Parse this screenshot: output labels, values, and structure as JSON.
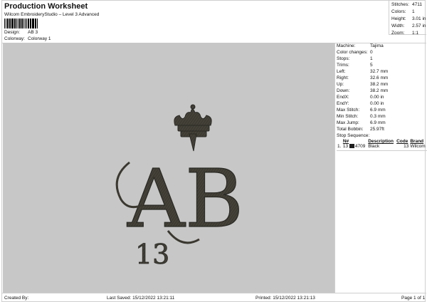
{
  "header": {
    "title": "Production Worksheet",
    "subtitle": "Wilcom EmbroideryStudio – Level 3 Advanced",
    "design_label": "Design:",
    "design_value": "AB 3",
    "colorway_label": "Colorway:",
    "colorway_value": "Colorway 1"
  },
  "stats": [
    {
      "label": "Stitches:",
      "value": "4711"
    },
    {
      "label": "Colors:",
      "value": "1"
    },
    {
      "label": "Height:",
      "value": "3.01 in"
    },
    {
      "label": "Width:",
      "value": "2.57 in"
    },
    {
      "label": "Zoom:",
      "value": "1:1"
    }
  ],
  "machine": [
    {
      "label": "Machine:",
      "value": "Tajima"
    },
    {
      "label": "Color changes:",
      "value": "0"
    },
    {
      "label": "Stops:",
      "value": "1"
    },
    {
      "label": "Trims:",
      "value": "5"
    },
    {
      "label": "Left:",
      "value": "32.7 mm"
    },
    {
      "label": "Right:",
      "value": "32.6 mm"
    },
    {
      "label": "Up:",
      "value": "38.2 mm"
    },
    {
      "label": "Down:",
      "value": "38.2 mm"
    },
    {
      "label": "EndX:",
      "value": "0.00 in"
    },
    {
      "label": "EndY:",
      "value": "0.00 in"
    },
    {
      "label": "Max Stitch:",
      "value": "6.9 mm"
    },
    {
      "label": "Min Stitch:",
      "value": "0.3 mm"
    },
    {
      "label": "Max Jump:",
      "value": "6.9 mm"
    },
    {
      "label": "Total Bobbin:",
      "value": "25.97ft"
    }
  ],
  "stop_sequence": {
    "title": "Stop Sequence:",
    "columns": [
      "N#",
      "Description",
      "Code",
      "Brand"
    ],
    "rows": [
      {
        "index": "1.",
        "n": "13",
        "stitches": "4709",
        "description": "Black",
        "code": "13",
        "brand": "Wilcom",
        "color": "#1f1f1f"
      }
    ]
  },
  "design_art": {
    "letters": "AB",
    "number": "13",
    "fill_color": "#3a382f",
    "background_color": "#c7c7c7"
  },
  "footer": {
    "created_by": "Created By:",
    "last_saved": "Last Saved: 15/12/2022 13:21:11",
    "printed": "Printed: 15/12/2022 13:21:13",
    "page": "Page 1 of 1"
  }
}
